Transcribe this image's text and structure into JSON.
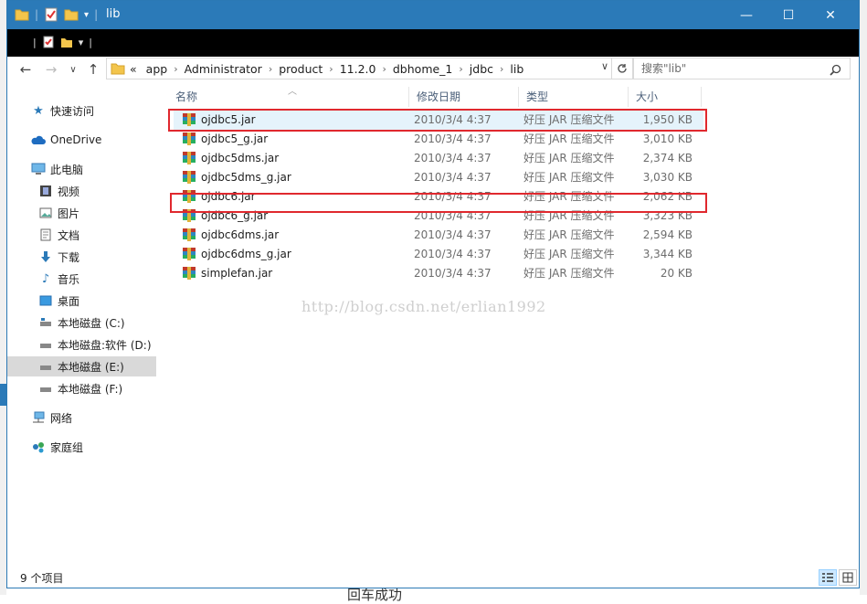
{
  "window": {
    "title": "lib",
    "min_glyph": "—",
    "max_glyph": "☐",
    "close_glyph": "✕"
  },
  "nav_buttons": {
    "back": "←",
    "forward": "→",
    "dropdown": "∨",
    "up": "↑"
  },
  "address": {
    "overflow": "«",
    "crumbs": [
      "app",
      "Administrator",
      "product",
      "11.2.0",
      "dbhome_1",
      "jdbc",
      "lib"
    ],
    "separator": "›"
  },
  "search": {
    "placeholder": "搜索\"lib\""
  },
  "navpane": {
    "items": [
      {
        "label": "快速访问",
        "icon": "star-icon"
      },
      {
        "label": "OneDrive",
        "icon": "cloud-icon"
      },
      {
        "label": "此电脑",
        "icon": "computer-icon"
      },
      {
        "label": "视频",
        "icon": "video-icon"
      },
      {
        "label": "图片",
        "icon": "picture-icon"
      },
      {
        "label": "文档",
        "icon": "document-icon"
      },
      {
        "label": "下载",
        "icon": "download-icon"
      },
      {
        "label": "音乐",
        "icon": "music-icon"
      },
      {
        "label": "桌面",
        "icon": "desktop-icon"
      },
      {
        "label": "本地磁盘 (C:)",
        "icon": "drive-icon"
      },
      {
        "label": "本地磁盘:软件 (D:)",
        "icon": "drive-icon"
      },
      {
        "label": "本地磁盘 (E:)",
        "icon": "drive-icon"
      },
      {
        "label": "本地磁盘 (F:)",
        "icon": "drive-icon"
      },
      {
        "label": "网络",
        "icon": "network-icon"
      },
      {
        "label": "家庭组",
        "icon": "homegroup-icon"
      }
    ]
  },
  "columns": {
    "name": "名称",
    "date": "修改日期",
    "type": "类型",
    "size": "大小"
  },
  "files": [
    {
      "name": "ojdbc5.jar",
      "date": "2010/3/4 4:37",
      "type": "好压 JAR 压缩文件",
      "size": "1,950 KB"
    },
    {
      "name": "ojdbc5_g.jar",
      "date": "2010/3/4 4:37",
      "type": "好压 JAR 压缩文件",
      "size": "3,010 KB"
    },
    {
      "name": "ojdbc5dms.jar",
      "date": "2010/3/4 4:37",
      "type": "好压 JAR 压缩文件",
      "size": "2,374 KB"
    },
    {
      "name": "ojdbc5dms_g.jar",
      "date": "2010/3/4 4:37",
      "type": "好压 JAR 压缩文件",
      "size": "3,030 KB"
    },
    {
      "name": "ojdbc6.jar",
      "date": "2010/3/4 4:37",
      "type": "好压 JAR 压缩文件",
      "size": "2,062 KB"
    },
    {
      "name": "ojdbc6_g.jar",
      "date": "2010/3/4 4:37",
      "type": "好压 JAR 压缩文件",
      "size": "3,323 KB"
    },
    {
      "name": "ojdbc6dms.jar",
      "date": "2010/3/4 4:37",
      "type": "好压 JAR 压缩文件",
      "size": "2,594 KB"
    },
    {
      "name": "ojdbc6dms_g.jar",
      "date": "2010/3/4 4:37",
      "type": "好压 JAR 压缩文件",
      "size": "3,344 KB"
    },
    {
      "name": "simplefan.jar",
      "date": "2010/3/4 4:37",
      "type": "好压 JAR 压缩文件",
      "size": "20 KB"
    }
  ],
  "watermark": "http://blog.csdn.net/erlian1992",
  "status": {
    "count": "9 个项目"
  },
  "below_text": "回车成功",
  "colors": {
    "titlebar": "#2b7ab8",
    "selection": "#e5f3fb",
    "annotation_red": "#e0282e"
  }
}
